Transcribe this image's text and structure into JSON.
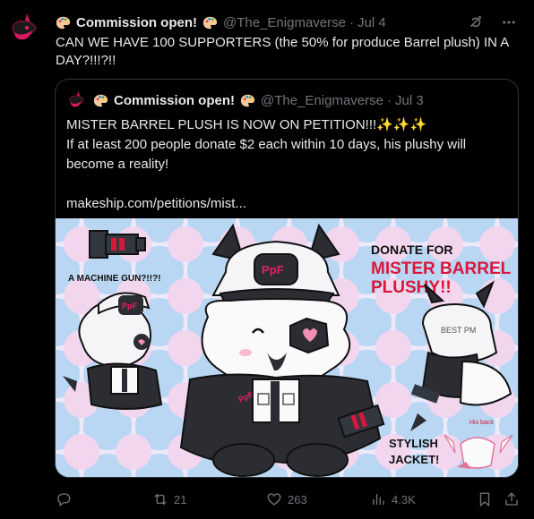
{
  "post": {
    "author_name": "Commission open!",
    "handle": "@The_Enigmaverse",
    "separator": "·",
    "date": "Jul 4",
    "text": "CAN WE HAVE 100 SUPPORTERS (the 50% for produce Barrel plush) IN A DAY?!!!?!!"
  },
  "quote": {
    "author_name": "Commission open!",
    "handle": "@The_Enigmaverse",
    "separator": "·",
    "date": "Jul 3",
    "line1": "MISTER BARREL PLUSH IS NOW ON PETITION!!!✨✨✨",
    "line2": "If at least 200 people donate $2 each within 10 days, his plushy will become a reality!",
    "link": "makeship.com/petitions/mist..."
  },
  "media": {
    "donate_title": "DONATE FOR",
    "donate_name_1": "MISTER BARREL",
    "donate_name_2": "PLUSHY!!",
    "gun_caption": "A MACHINE GUN?!!?!",
    "jacket_caption_1": "STYLISH",
    "jacket_caption_2": "JACKET!",
    "hat_badge": "PpF",
    "small_hat_badge": "PpF",
    "back_label": "BEST PM",
    "his_back": "His back",
    "arm_label": "PpF"
  },
  "actions": {
    "replies": "",
    "retweets": "21",
    "likes": "263",
    "views": "4.3K"
  },
  "colors": {
    "background": "#000000",
    "text": "#e7e9ea",
    "muted": "#71767b",
    "border": "#2f3336",
    "donate_red": "#d9173b"
  },
  "icons": [
    "grok-icon",
    "more-icon",
    "reply-icon",
    "retweet-icon",
    "like-icon",
    "views-icon",
    "bookmark-icon",
    "share-icon",
    "palette-icon"
  ]
}
